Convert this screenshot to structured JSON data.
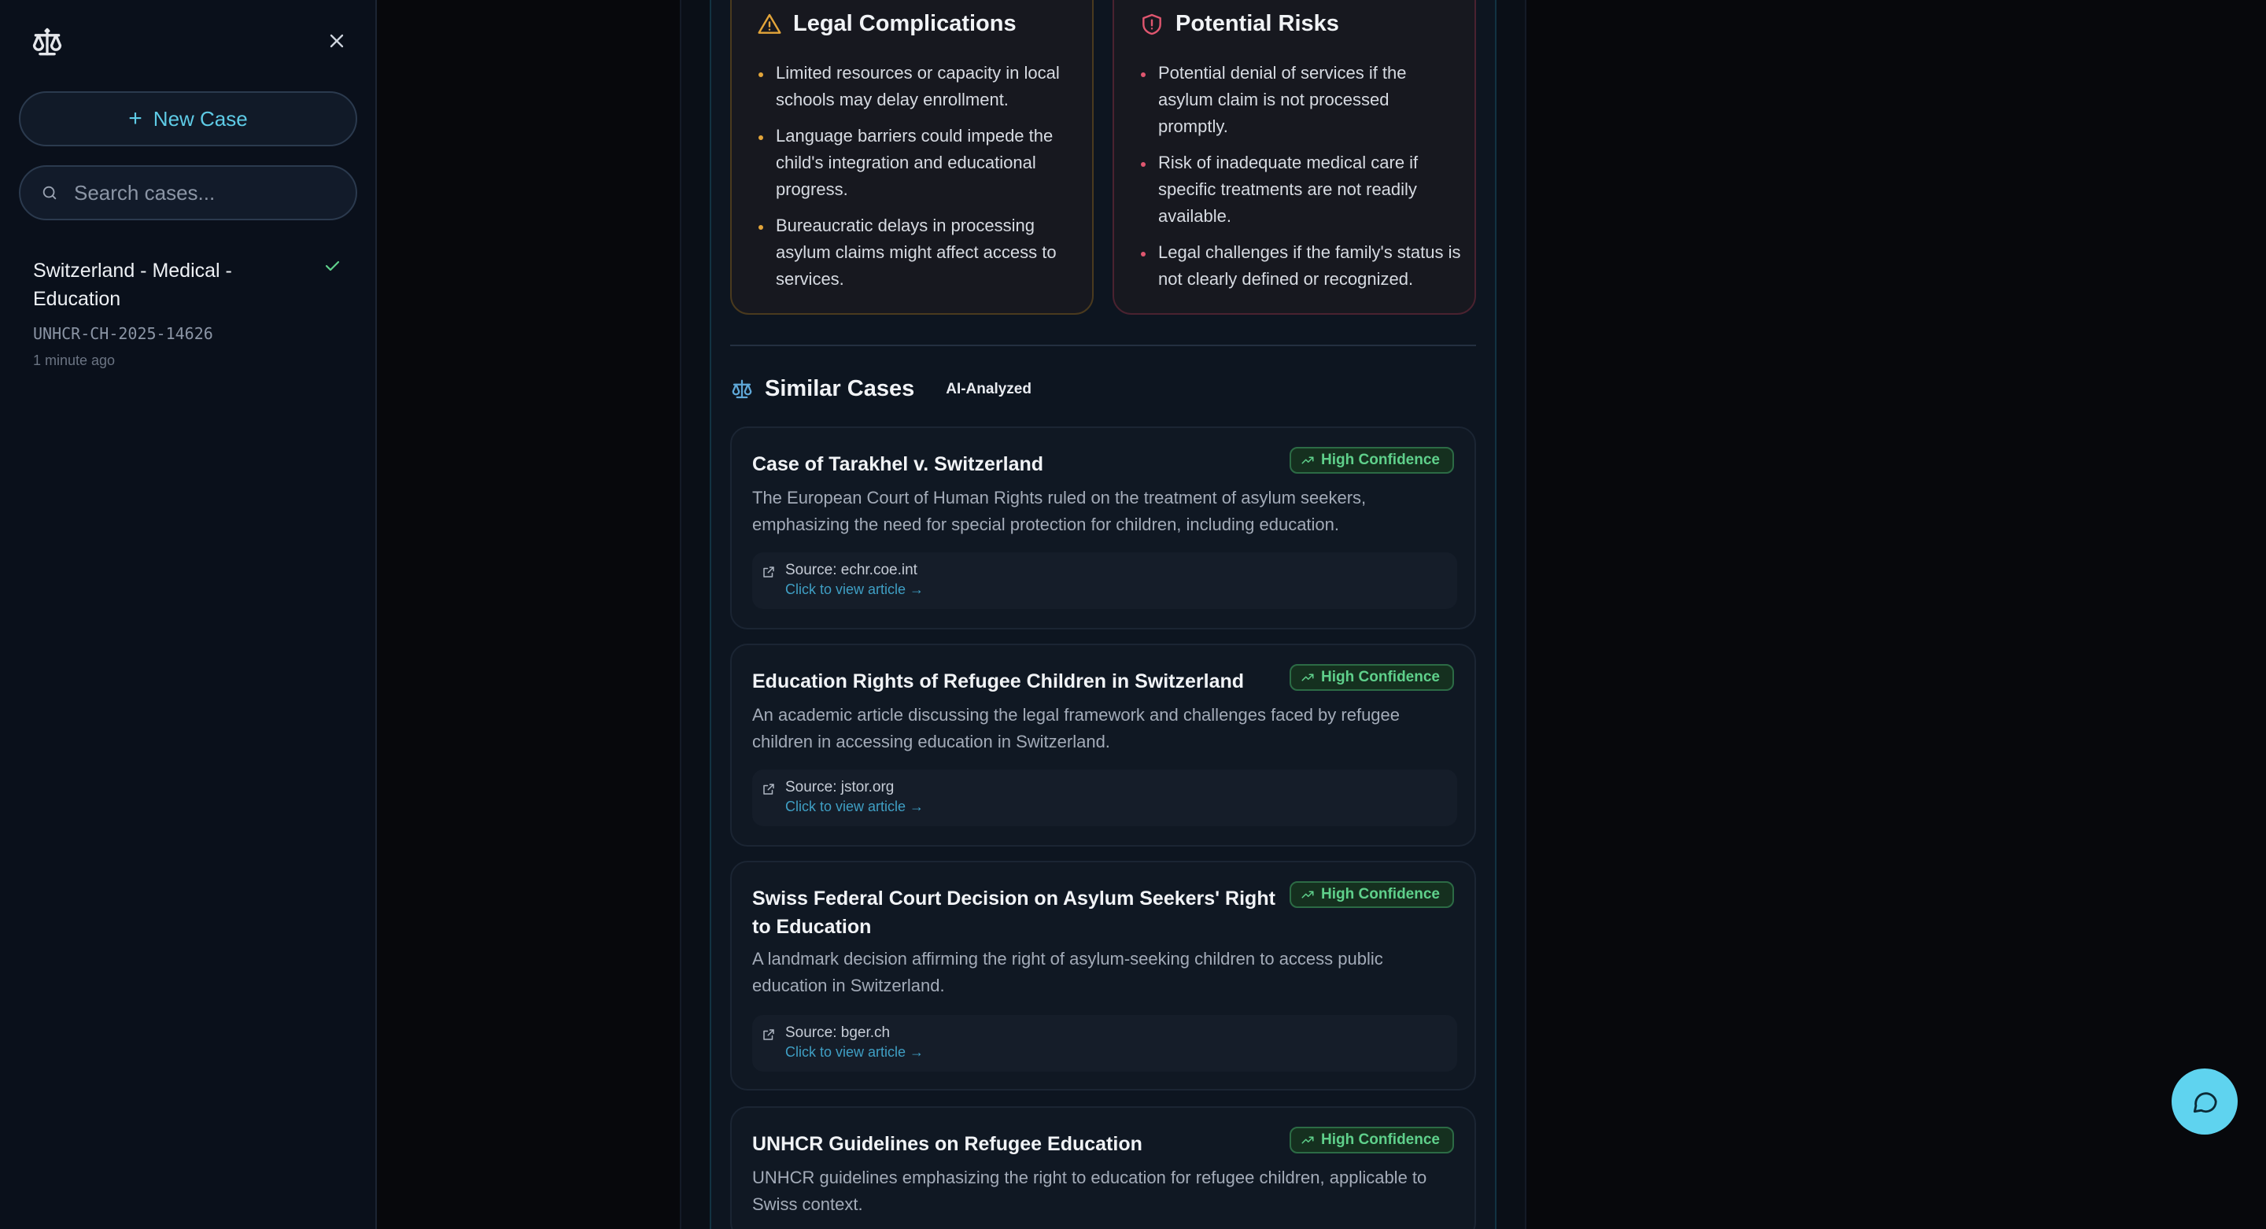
{
  "sidebar": {
    "new_case_label": "New Case",
    "search_placeholder": "Search cases...",
    "cases": [
      {
        "title": "Switzerland - Medical - Education",
        "id": "UNHCR-CH-2025-14626",
        "time": "1 minute ago"
      }
    ]
  },
  "legal": {
    "title": "Legal Complications",
    "items": [
      "Limited resources or capacity in local schools may delay enrollment.",
      "Language barriers could impede the child's integration and educational progress.",
      "Bureaucratic delays in processing asylum claims might affect access to services."
    ]
  },
  "risks": {
    "title": "Potential Risks",
    "items": [
      "Potential denial of services if the asylum claim is not processed promptly.",
      "Risk of inadequate medical care if specific treatments are not readily available.",
      "Legal challenges if the family's status is not clearly defined or recognized."
    ]
  },
  "similar": {
    "title": "Similar Cases",
    "badge": "AI-Analyzed",
    "cases": [
      {
        "title": "Case of Tarakhel v. Switzerland",
        "confidence": "High Confidence",
        "description": "The European Court of Human Rights ruled on the treatment of asylum seekers, emphasizing the need for special protection for children, including education.",
        "source": "Source: echr.coe.int",
        "link": "Click to view article →"
      },
      {
        "title": "Education Rights of Refugee Children in Switzerland",
        "confidence": "High Confidence",
        "description": "An academic article discussing the legal framework and challenges faced by refugee children in accessing education in Switzerland.",
        "source": "Source: jstor.org",
        "link": "Click to view article →"
      },
      {
        "title": "Swiss Federal Court Decision on Asylum Seekers' Right to Education",
        "confidence": "High Confidence",
        "description": "A landmark decision affirming the right of asylum-seeking children to access public education in Switzerland.",
        "source": "Source: bger.ch",
        "link": "Click to view article →"
      },
      {
        "title": "UNHCR Guidelines on Refugee Education",
        "confidence": "High Confidence",
        "description": "UNHCR guidelines emphasizing the right to education for refugee children, applicable to Swiss context."
      }
    ]
  },
  "colors": {
    "accent": "#5fd3ef",
    "warning": "#e3a53a",
    "danger": "#e0566f",
    "success": "#5fd08b"
  },
  "icons": {
    "logo": "scales-icon",
    "close": "close-icon",
    "search": "search-icon",
    "legal": "warning-triangle-icon",
    "risk": "shield-icon",
    "confidence": "trending-up-icon",
    "source": "external-link-icon",
    "fab": "chat-bubble-icon"
  }
}
